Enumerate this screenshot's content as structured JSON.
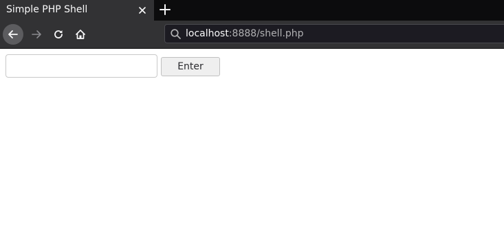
{
  "tab": {
    "title": "Simple PHP Shell",
    "close_icon": "close-icon",
    "new_tab_icon": "plus-icon"
  },
  "navbar": {
    "back_icon": "arrow-left-icon",
    "forward_icon": "arrow-right-icon",
    "reload_icon": "reload-icon",
    "home_icon": "home-icon"
  },
  "urlbar": {
    "search_icon": "search-icon",
    "host": "localhost",
    "rest": ":8888/shell.php"
  },
  "form": {
    "input_value": "",
    "input_placeholder": "",
    "submit_label": "Enter"
  },
  "colors": {
    "tab_strip": "#0c0c0d",
    "toolbar": "#323234",
    "urlbar_bg": "#1c1b22",
    "page_bg": "#ffffff"
  }
}
